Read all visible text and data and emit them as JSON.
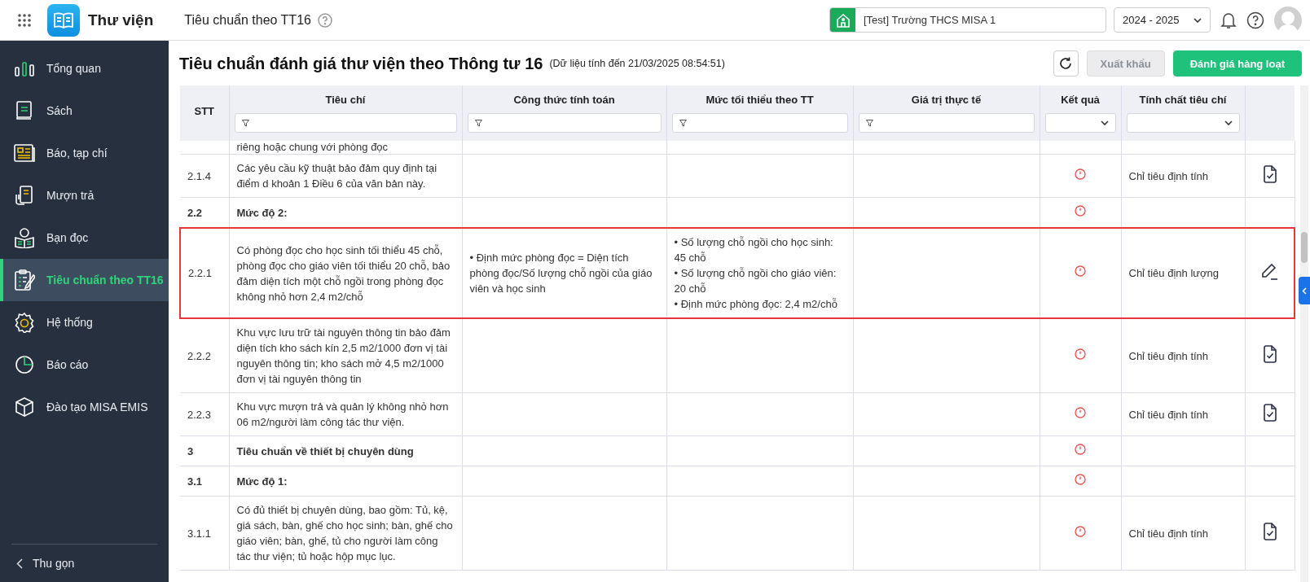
{
  "app": {
    "title": "Thư viện",
    "page": "Tiêu chuẩn theo TT16"
  },
  "school": {
    "value": "[Test] Trường THCS MISA 1"
  },
  "year": {
    "value": "2024 - 2025"
  },
  "sidebar": {
    "items": [
      {
        "kind": "overview",
        "label": "Tổng quan",
        "selected": false
      },
      {
        "kind": "books",
        "label": "Sách",
        "selected": false
      },
      {
        "kind": "periodicals",
        "label": "Báo, tạp chí",
        "selected": false
      },
      {
        "kind": "loans",
        "label": "Mượn trả",
        "selected": false
      },
      {
        "kind": "readers",
        "label": "Bạn đọc",
        "selected": false
      },
      {
        "kind": "standards",
        "label": "Tiêu chuẩn theo TT16",
        "selected": true
      },
      {
        "kind": "system",
        "label": "Hệ thống",
        "selected": false
      },
      {
        "kind": "reports",
        "label": "Báo cáo",
        "selected": false
      },
      {
        "kind": "training",
        "label": "Đào tạo MISA EMIS",
        "selected": false
      }
    ],
    "collapse": "Thu gọn"
  },
  "heading": {
    "title": "Tiêu chuẩn đánh giá thư viện theo Thông tư 16",
    "note": "(Dữ liệu tính đến 21/03/2025 08:54:51)"
  },
  "toolbar": {
    "buttons": [
      {
        "kind": "refresh",
        "disabled": false
      },
      {
        "kind": "text",
        "label": "Xuất khẩu",
        "disabled": true
      },
      {
        "kind": "primary",
        "label": "Đánh giá hàng loạt",
        "disabled": false
      }
    ]
  },
  "table": {
    "columns": [
      {
        "kind": "plain",
        "label": "STT"
      },
      {
        "kind": "text",
        "label": "Tiêu chí"
      },
      {
        "kind": "text",
        "label": "Công thức tính toán"
      },
      {
        "kind": "text",
        "label": "Mức tối thiểu theo TT"
      },
      {
        "kind": "text",
        "label": "Giá trị thực tế"
      },
      {
        "kind": "select",
        "label": "Kết quả"
      },
      {
        "kind": "select",
        "label": "Tính chất tiêu chí"
      },
      {
        "kind": "plain"
      }
    ],
    "rows": [
      {
        "kind": "partial",
        "criterion": "riêng hoặc chung với phòng đọc",
        "selected": false
      },
      {
        "kind": "item",
        "stt": "2.1.4",
        "criterion": "Các yêu cầu kỹ thuật bảo đảm quy định tại điểm d khoản 1 Điều 6 của văn bản này.",
        "warning": true,
        "nature": "Chỉ tiêu định tính",
        "editable": false,
        "selected": false
      },
      {
        "kind": "group",
        "stt": "2.2",
        "criterion": "Mức độ 2:",
        "warning": true,
        "selected": false
      },
      {
        "kind": "item",
        "stt": "2.2.1",
        "criterion": "Có phòng đọc cho học sinh tối thiểu 45 chỗ, phòng đọc cho giáo viên tối thiểu 20 chỗ, bảo đảm diện tích một chỗ ngồi trong phòng đọc không nhỏ hơn 2,4 m2/chỗ",
        "formula": [
          "• Định mức phòng đọc = Diện tích phòng đọc/Số lượng chỗ ngồi của giáo viên và học sinh"
        ],
        "minimum": [
          "• Số lượng chỗ ngồi cho học sinh: 45 chỗ",
          "• Số lượng chỗ ngồi cho giáo viên: 20 chỗ",
          "• Định mức phòng đọc: 2,4 m2/chỗ"
        ],
        "warning": true,
        "nature": "Chỉ tiêu định lượng",
        "editable": true,
        "selected": true
      },
      {
        "kind": "item",
        "stt": "2.2.2",
        "criterion": "Khu vực lưu trữ tài nguyên thông tin bảo đảm diện tích kho sách kín 2,5 m2/1000 đơn vị tài nguyên thông tin; kho sách mở 4,5 m2/1000 đơn vị tài nguyên thông tin",
        "warning": true,
        "nature": "Chỉ tiêu định tính",
        "editable": false,
        "selected": false
      },
      {
        "kind": "item",
        "stt": "2.2.3",
        "criterion": "Khu vực mượn trả và quản lý không nhỏ hơn 06 m2/người làm công tác thư viện.",
        "warning": true,
        "nature": "Chỉ tiêu định tính",
        "editable": false,
        "selected": false
      },
      {
        "kind": "group",
        "stt": "3",
        "criterion": "Tiêu chuẩn về thiết bị chuyên dùng",
        "warning": true,
        "selected": false
      },
      {
        "kind": "group",
        "stt": "3.1",
        "criterion": "Mức độ 1:",
        "warning": true,
        "selected": false
      },
      {
        "kind": "item",
        "stt": "3.1.1",
        "criterion": "Có đủ thiết bị chuyên dùng, bao gồm: Tủ, kệ, giá sách, bàn, ghế cho học sinh; bàn, ghế cho giáo viên; bàn, ghế, tủ cho người làm công tác thư viện; tủ hoặc hộp mục lục.",
        "warning": true,
        "nature": "Chỉ tiêu định tính",
        "editable": false,
        "selected": false
      }
    ]
  }
}
